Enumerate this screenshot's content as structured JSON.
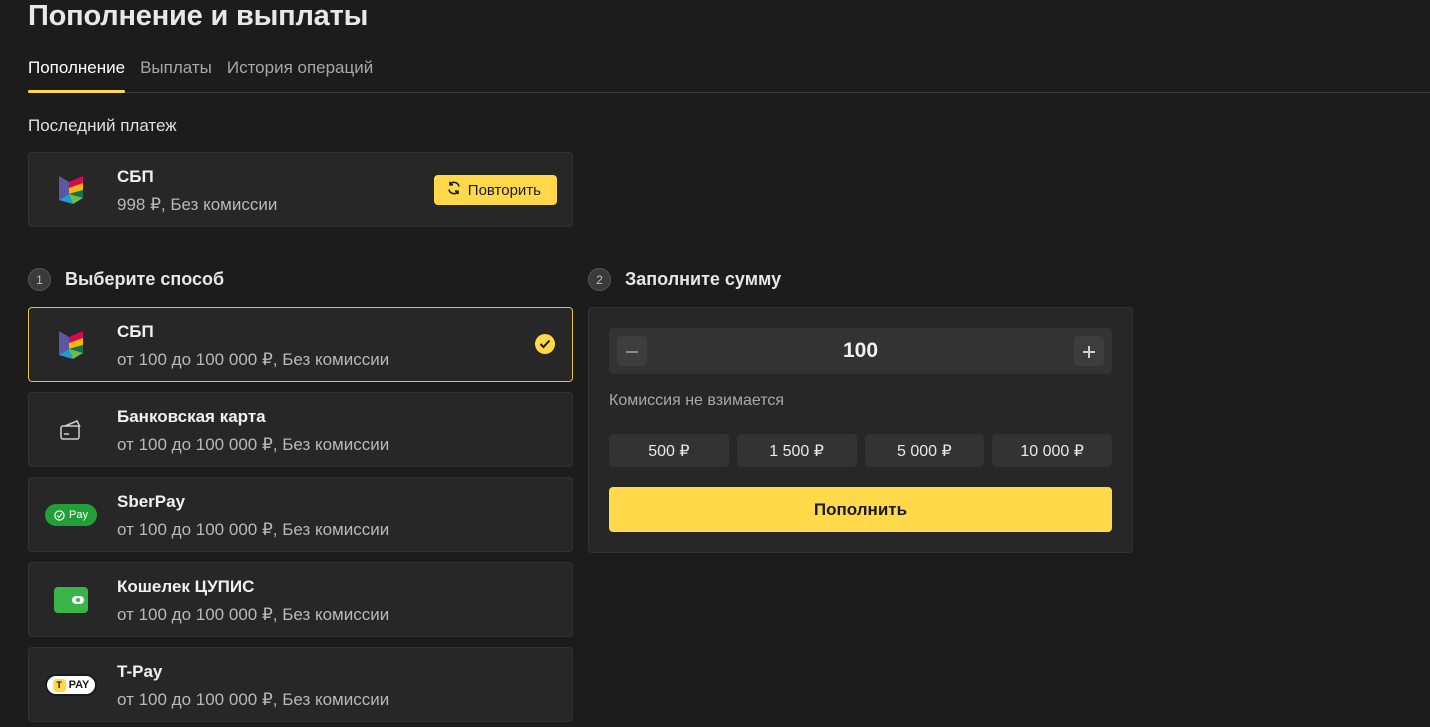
{
  "page": {
    "title": "Пополнение и выплаты"
  },
  "tabs": [
    {
      "label": "Пополнение",
      "active": true
    },
    {
      "label": "Выплаты",
      "active": false
    },
    {
      "label": "История операций",
      "active": false
    }
  ],
  "last_payment": {
    "section_label": "Последний платеж",
    "method": "СБП",
    "details": "998 ₽, Без комиссии",
    "repeat_label": "Повторить",
    "icon": "sbp-logo-icon"
  },
  "step1": {
    "number": "1",
    "label": "Выберите способ"
  },
  "step2": {
    "number": "2",
    "label": "Заполните сумму"
  },
  "methods": [
    {
      "name": "СБП",
      "desc": "от 100 до 100 000 ₽, Без комиссии",
      "icon": "sbp-logo-icon",
      "selected": true
    },
    {
      "name": "Банковская карта",
      "desc": "от 100 до 100 000 ₽, Без комиссии",
      "icon": "bank-card-icon",
      "selected": false
    },
    {
      "name": "SberPay",
      "desc": "от 100 до 100 000 ₽, Без комиссии",
      "icon": "sberpay-logo-icon",
      "logo_text": "Pay",
      "selected": false
    },
    {
      "name": "Кошелек ЦУПИС",
      "desc": "от 100 до 100 000 ₽, Без комиссии",
      "icon": "wallet-icon",
      "selected": false
    },
    {
      "name": "T-Pay",
      "desc": "от 100 до 100 000 ₽, Без комиссии",
      "icon": "tpay-logo-icon",
      "logo_text": "PAY",
      "selected": false
    }
  ],
  "amount": {
    "value": "100",
    "commission_note": "Комиссия не взимается",
    "presets": [
      "500 ₽",
      "1 500 ₽",
      "5 000 ₽",
      "10 000 ₽"
    ],
    "submit_label": "Пополнить"
  },
  "colors": {
    "accent": "#ffd94a",
    "background": "#1c1c1c",
    "card": "#272727",
    "sber_green": "#21a038",
    "wallet_green": "#3bb54a"
  }
}
